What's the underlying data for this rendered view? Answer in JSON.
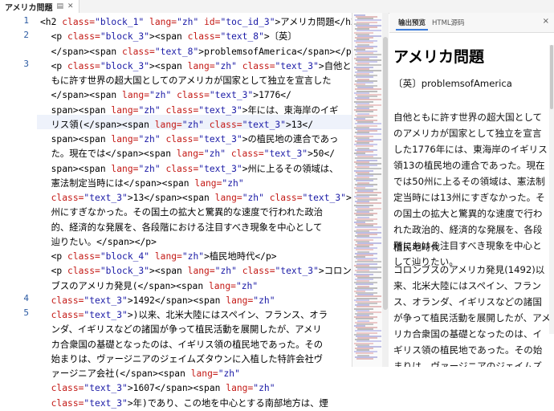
{
  "tab": {
    "title": "アメリカ問題",
    "icon1": "doc-icon",
    "icon2": "close-icon"
  },
  "gutter": [
    "1",
    "2",
    "3",
    "4",
    "5"
  ],
  "code_rows": [
    [
      {
        "t": "<h2 ",
        "c": "#000"
      },
      {
        "t": "class=",
        "c": "#c41a16"
      },
      {
        "t": "\"block_1\" ",
        "c": "#1a1aa6"
      },
      {
        "t": "lang=",
        "c": "#c41a16"
      },
      {
        "t": "\"zh\" ",
        "c": "#1a1aa6"
      },
      {
        "t": "id=",
        "c": "#c41a16"
      },
      {
        "t": "\"toc_id_3\"",
        "c": "#1a1aa6"
      },
      {
        "t": ">アメリカ問題</h2>",
        "c": "#000"
      }
    ],
    [
      {
        "t": "  <p ",
        "c": "#000"
      },
      {
        "t": "class=",
        "c": "#c41a16"
      },
      {
        "t": "\"block_3\"",
        "c": "#1a1aa6"
      },
      {
        "t": "><span ",
        "c": "#000"
      },
      {
        "t": "class=",
        "c": "#c41a16"
      },
      {
        "t": "\"text_8\"",
        "c": "#1a1aa6"
      },
      {
        "t": ">〔英〕",
        "c": "#000"
      }
    ],
    [
      {
        "t": "  </span><span ",
        "c": "#000"
      },
      {
        "t": "class=",
        "c": "#c41a16"
      },
      {
        "t": "\"text_8\"",
        "c": "#1a1aa6"
      },
      {
        "t": ">problemsofAmerica</span></p>",
        "c": "#000"
      }
    ],
    [
      {
        "t": "  <p ",
        "c": "#000"
      },
      {
        "t": "class=",
        "c": "#c41a16"
      },
      {
        "t": "\"block_3\"",
        "c": "#1a1aa6"
      },
      {
        "t": "><span ",
        "c": "#000"
      },
      {
        "t": "lang=",
        "c": "#c41a16"
      },
      {
        "t": "\"zh\" ",
        "c": "#1a1aa6"
      },
      {
        "t": "class=",
        "c": "#c41a16"
      },
      {
        "t": "\"text_3\"",
        "c": "#1a1aa6"
      },
      {
        "t": ">自他と",
        "c": "#000"
      }
    ],
    [
      {
        "t": "  もに許す世界の超大国としてのアメリカが国家として独立を宣言した",
        "c": "#000"
      }
    ],
    [
      {
        "t": "  </span><span ",
        "c": "#000"
      },
      {
        "t": "lang=",
        "c": "#c41a16"
      },
      {
        "t": "\"zh\" ",
        "c": "#1a1aa6"
      },
      {
        "t": "class=",
        "c": "#c41a16"
      },
      {
        "t": "\"text_3\"",
        "c": "#1a1aa6"
      },
      {
        "t": ">1776</",
        "c": "#000"
      }
    ],
    [
      {
        "t": "  span><span ",
        "c": "#000"
      },
      {
        "t": "lang=",
        "c": "#c41a16"
      },
      {
        "t": "\"zh\" ",
        "c": "#1a1aa6"
      },
      {
        "t": "class=",
        "c": "#c41a16"
      },
      {
        "t": "\"text_3\"",
        "c": "#1a1aa6"
      },
      {
        "t": ">年には、東海岸のイギ",
        "c": "#000"
      }
    ],
    [
      {
        "t": "  リス領(</span><span ",
        "c": "#000"
      },
      {
        "t": "lang=",
        "c": "#c41a16"
      },
      {
        "t": "\"zh\" ",
        "c": "#1a1aa6"
      },
      {
        "t": "class=",
        "c": "#c41a16"
      },
      {
        "t": "\"text_3\"",
        "c": "#1a1aa6"
      },
      {
        "t": ">13</",
        "c": "#000"
      }
    ],
    [
      {
        "t": "  span><span ",
        "c": "#000"
      },
      {
        "t": "lang=",
        "c": "#c41a16"
      },
      {
        "t": "\"zh\" ",
        "c": "#1a1aa6"
      },
      {
        "t": "class=",
        "c": "#c41a16"
      },
      {
        "t": "\"text_3\"",
        "c": "#1a1aa6"
      },
      {
        "t": ">の植民地の連合であっ",
        "c": "#000"
      }
    ],
    [
      {
        "t": "  た。現在では</span><span ",
        "c": "#000"
      },
      {
        "t": "lang=",
        "c": "#c41a16"
      },
      {
        "t": "\"zh\" ",
        "c": "#1a1aa6"
      },
      {
        "t": "class=",
        "c": "#c41a16"
      },
      {
        "t": "\"text_3\"",
        "c": "#1a1aa6"
      },
      {
        "t": ">50</",
        "c": "#000"
      }
    ],
    [
      {
        "t": "  span><span ",
        "c": "#000"
      },
      {
        "t": "lang=",
        "c": "#c41a16"
      },
      {
        "t": "\"zh\" ",
        "c": "#1a1aa6"
      },
      {
        "t": "class=",
        "c": "#c41a16"
      },
      {
        "t": "\"text_3\"",
        "c": "#1a1aa6"
      },
      {
        "t": ">州に上るその領域は、",
        "c": "#000"
      }
    ],
    [
      {
        "t": "  憲法制定当時には</span><span ",
        "c": "#000"
      },
      {
        "t": "lang=",
        "c": "#c41a16"
      },
      {
        "t": "\"zh\"",
        "c": "#1a1aa6"
      }
    ],
    [
      {
        "t": "  ",
        "c": "#000"
      },
      {
        "t": "class=",
        "c": "#c41a16"
      },
      {
        "t": "\"text_3\"",
        "c": "#1a1aa6"
      },
      {
        "t": ">13</span><span ",
        "c": "#000"
      },
      {
        "t": "lang=",
        "c": "#c41a16"
      },
      {
        "t": "\"zh\" ",
        "c": "#1a1aa6"
      },
      {
        "t": "class=",
        "c": "#c41a16"
      },
      {
        "t": "\"text_3\"",
        "c": "#1a1aa6"
      },
      {
        "t": ">",
        "c": "#000"
      }
    ],
    [
      {
        "t": "  州にすぎなかった。その国土の拡大と驚異的な速度で行われた政治",
        "c": "#000"
      }
    ],
    [
      {
        "t": "  的、経済的な発展を、各段階における注目すべき現象を中心として",
        "c": "#000"
      }
    ],
    [
      {
        "t": "  辿りたい。</span></p>",
        "c": "#000"
      }
    ],
    [
      {
        "t": "  <p ",
        "c": "#000"
      },
      {
        "t": "class=",
        "c": "#c41a16"
      },
      {
        "t": "\"block_4\" ",
        "c": "#1a1aa6"
      },
      {
        "t": "lang=",
        "c": "#c41a16"
      },
      {
        "t": "\"zh\"",
        "c": "#1a1aa6"
      },
      {
        "t": ">植民地時代</p>",
        "c": "#000"
      }
    ],
    [
      {
        "t": "  <p ",
        "c": "#000"
      },
      {
        "t": "class=",
        "c": "#c41a16"
      },
      {
        "t": "\"block_3\"",
        "c": "#1a1aa6"
      },
      {
        "t": "><span ",
        "c": "#000"
      },
      {
        "t": "lang=",
        "c": "#c41a16"
      },
      {
        "t": "\"zh\" ",
        "c": "#1a1aa6"
      },
      {
        "t": "class=",
        "c": "#c41a16"
      },
      {
        "t": "\"text_3\"",
        "c": "#1a1aa6"
      },
      {
        "t": ">コロン",
        "c": "#000"
      }
    ],
    [
      {
        "t": "  ブスのアメリカ発見(</span><span ",
        "c": "#000"
      },
      {
        "t": "lang=",
        "c": "#c41a16"
      },
      {
        "t": "\"zh\"",
        "c": "#1a1aa6"
      }
    ],
    [
      {
        "t": "  ",
        "c": "#000"
      },
      {
        "t": "class=",
        "c": "#c41a16"
      },
      {
        "t": "\"text_3\"",
        "c": "#1a1aa6"
      },
      {
        "t": ">1492</span><span ",
        "c": "#000"
      },
      {
        "t": "lang=",
        "c": "#c41a16"
      },
      {
        "t": "\"zh\"",
        "c": "#1a1aa6"
      }
    ],
    [
      {
        "t": "  ",
        "c": "#000"
      },
      {
        "t": "class=",
        "c": "#c41a16"
      },
      {
        "t": "\"text_3\"",
        "c": "#1a1aa6"
      },
      {
        "t": ">)以来、北米大陸にはスペイン、フランス、オラ",
        "c": "#000"
      }
    ],
    [
      {
        "t": "  ンダ、イギリスなどの諸国が争って植民活動を展開したが、アメリ",
        "c": "#000"
      }
    ],
    [
      {
        "t": "  カ合衆国の基礎となったのは、イギリス領の植民地であった。その",
        "c": "#000"
      }
    ],
    [
      {
        "t": "  始まりは、ヴァージニアのジェイムズタウンに入植した特許会社ヴ",
        "c": "#000"
      }
    ],
    [
      {
        "t": "  ァージニア会社(</span><span ",
        "c": "#000"
      },
      {
        "t": "lang=",
        "c": "#c41a16"
      },
      {
        "t": "\"zh\"",
        "c": "#1a1aa6"
      }
    ],
    [
      {
        "t": "  ",
        "c": "#000"
      },
      {
        "t": "class=",
        "c": "#c41a16"
      },
      {
        "t": "\"text_3\"",
        "c": "#1a1aa6"
      },
      {
        "t": ">1607</span><span ",
        "c": "#000"
      },
      {
        "t": "lang=",
        "c": "#c41a16"
      },
      {
        "t": "\"zh\"",
        "c": "#1a1aa6"
      }
    ],
    [
      {
        "t": "  ",
        "c": "#000"
      },
      {
        "t": "class=",
        "c": "#c41a16"
      },
      {
        "t": "\"text_3\"",
        "c": "#1a1aa6"
      },
      {
        "t": ">年)であり、この地を中心とする南部地方は、煙",
        "c": "#000"
      }
    ]
  ],
  "preview": {
    "tab_active": "输出预览",
    "tab_other": "HTML源码",
    "close": "×",
    "title": "アメリカ問題",
    "subtitle": "〔英〕problemsofAmerica",
    "para1": "自他ともに許す世界の超大国としてのアメリカが国家として独立を宣言した1776年には、東海岸のイギリス領13の植民地の連合であった。現在では50州に上るその領域は、憲法制定当時には13州にすぎなかった。その国土の拡大と驚異的な速度で行われた政治的、経済的な発展を、各段階における注目すべき現象を中心として辿りたい。",
    "heading2": "植民地時代",
    "para2": "コロンブスのアメリカ発見(1492)以来、北米大陸にはスペイン、フランス、オランダ、イギリスなどの諸国が争って植民活動を展開したが、アメリカ合衆国の基礎となったのは、イギリス領の植民地であった。その始まりは、ヴァージニアのジェイムズタウン"
  }
}
